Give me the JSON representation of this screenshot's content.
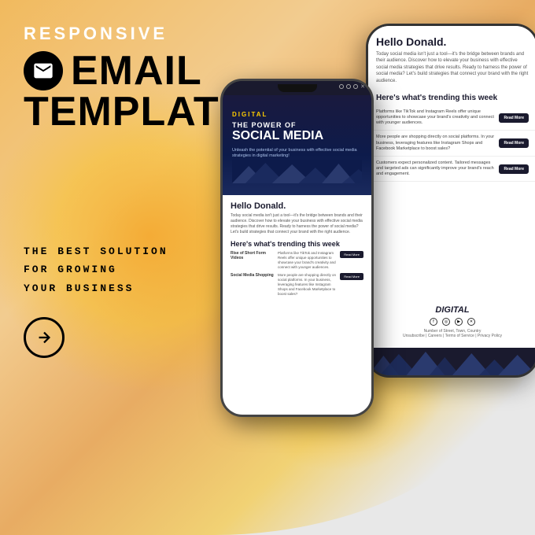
{
  "header": {
    "responsive_label": "RESPONSIVE",
    "email_title": "EMAIL",
    "templates_title": "TEMPLATES"
  },
  "email_icon": "✉",
  "tagline": {
    "line1": "THE BEST SOLUTION",
    "line2": "FOR GROWING",
    "line3": "YOUR BUSINESS"
  },
  "arrow_label": "→",
  "back_phone": {
    "hello": "Hello Donald.",
    "intro": "Today social media isn't just a tool—it's the bridge between brands and their audience. Discover how to elevate your business with effective social media strategies that drive results. Ready to harness the power of social media? Let's build strategies that connect your brand with the right audience.",
    "trending_title": "Here's what's trending this week",
    "items": [
      {
        "text": "Platforms like TikTok and Instagram Reels offer unique opportunities to showcase your brand's creativity and connect with younger audiences.",
        "button": "Read More"
      },
      {
        "text": "More people are shopping directly on social platforms. In your business, leveraging features like Instagram Shops and Facebook Marketplace to boost sales?",
        "button": "Read More"
      },
      {
        "text": "Customers expect personalized content. Tailored messages and targeted ads can significantly improve your brand's reach and engagement.",
        "button": "Read More"
      }
    ],
    "footer": {
      "brand": "DIGITAL",
      "address": "Number of Street, Town, Country",
      "links": "Unsubscribe | Careers | Terms of Service | Privacy Policy"
    }
  },
  "front_phone": {
    "digital_label": "DIGITAL",
    "power_of": "THE POWER OF",
    "social_media": "SOCIAL MEDIA",
    "subtitle": "Unleash the potential of your business with effective social media strategies in digital marketing!",
    "hello": "Hello Donald.",
    "intro": "Today social media isn't just a tool—it's the bridge between brands and their audience. Discover how to elevate your business with effective social media strategies that drive results. Ready to harness the power of social media? Let's build strategies that connect your brand with the right audience.",
    "trending_title": "Here's what's trending this week",
    "items": [
      {
        "label": "Rise of Short Form Videos",
        "desc": "Platforms like TikTok and Instagram Reels offer unique opportunities to showcase your brand's creativity and connect with younger audiences.",
        "button": "Read More"
      },
      {
        "label": "Social Media Shopping",
        "desc": "More people are shopping directly on social platforms. In your business, leveraging features like Instagram Shops and Facebook Marketplace to boost sales?",
        "button": "Read More"
      }
    ]
  }
}
